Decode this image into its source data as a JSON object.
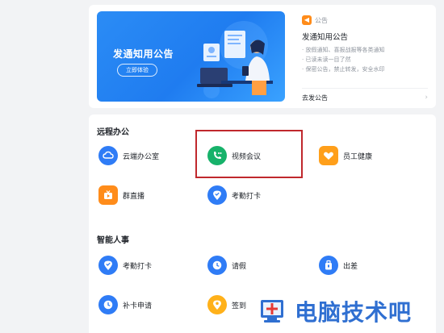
{
  "announcement_banner": {
    "title": "发通知用公告",
    "cta_label": "立即体验"
  },
  "notice_panel": {
    "tag": "公告",
    "title": "发通知用公告",
    "bullets": [
      "· 放假通知、喜报战报等各类通知",
      "· 已读未读一目了然",
      "· 保密公告，禁止转发，安全水印"
    ],
    "action_label": "去发公告",
    "action_chevron": "›"
  },
  "sections": [
    {
      "title": "远程办公",
      "apps": [
        {
          "label": "云端办公室",
          "icon": "cloud-office-icon",
          "color": "#2f7cf6"
        },
        {
          "label": "视频会议",
          "icon": "video-call-icon",
          "color": "#17b26a"
        },
        {
          "label": "员工健康",
          "icon": "heart-health-icon",
          "color": "#ff9f1a"
        },
        {
          "label": "群直播",
          "icon": "live-broadcast-icon",
          "color": "#ff8c1a"
        },
        {
          "label": "考勤打卡",
          "icon": "location-checkin-icon",
          "color": "#2f7cf6"
        }
      ]
    },
    {
      "title": "智能人事",
      "apps": [
        {
          "label": "考勤打卡",
          "icon": "location-checkin-icon",
          "color": "#2f7cf6"
        },
        {
          "label": "请假",
          "icon": "clock-leave-icon",
          "color": "#2f7cf6"
        },
        {
          "label": "出差",
          "icon": "suitcase-icon",
          "color": "#2f7cf6"
        },
        {
          "label": "补卡申请",
          "icon": "clock-reissue-icon",
          "color": "#2f7cf6"
        },
        {
          "label": "签到",
          "icon": "location-signin-icon",
          "color": "#ffb11a"
        }
      ]
    }
  ],
  "watermark": {
    "text": "电脑技术吧"
  }
}
